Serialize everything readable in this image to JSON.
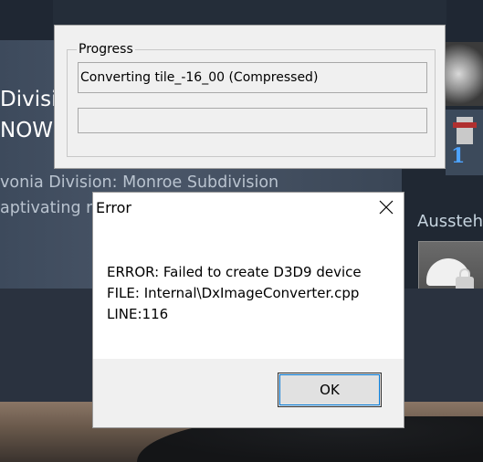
{
  "background": {
    "title_line1": "Division",
    "title_line2": "NOW",
    "subtitle_line1": "vonia Division: Monroe Subdivision",
    "subtitle_line2": "aptivating r",
    "side_label": "Ausstehe",
    "achievement_number": "1",
    "icons": [
      "achievement-gauge-icon",
      "achievement-medal-icon",
      "achievement-locked-cap-icon"
    ]
  },
  "progress_window": {
    "group_label": "Progress",
    "status_text": "Converting tile_-16_00 (Compressed)",
    "progress": 0
  },
  "error_dialog": {
    "title": "Error",
    "close_icon": "close-icon",
    "lines": [
      "ERROR: Failed to create D3D9 device",
      "FILE: Internal\\DxImageConverter.cpp",
      "LINE:116"
    ],
    "ok_label": "OK"
  }
}
